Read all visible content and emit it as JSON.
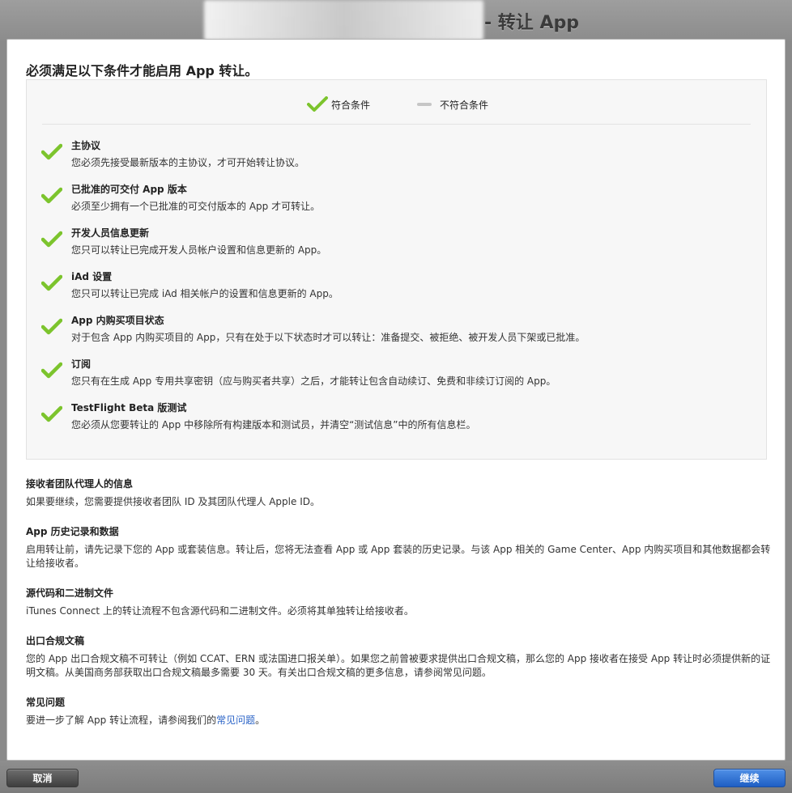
{
  "window": {
    "title": "- 转让 App"
  },
  "main": {
    "headline": "必须满足以下条件才能启用 App 转让。",
    "legend": {
      "met_label": "符合条件",
      "unmet_label": "不符合条件",
      "met_icon": "check-icon",
      "unmet_icon": "dash-icon"
    },
    "conditions": [
      {
        "title": "主协议",
        "desc": "您必须先接受最新版本的主协议，才可开始转让协议。",
        "status": "met"
      },
      {
        "title": "已批准的可交付 App 版本",
        "desc": "必须至少拥有一个已批准的可交付版本的 App 才可转让。",
        "status": "met"
      },
      {
        "title": "开发人员信息更新",
        "desc": "您只可以转让已完成开发人员帐户设置和信息更新的 App。",
        "status": "met"
      },
      {
        "title": "iAd 设置",
        "desc": "您只可以转让已完成 iAd 相关帐户的设置和信息更新的 App。",
        "status": "met"
      },
      {
        "title": "App 内购买项目状态",
        "desc": "对于包含 App 内购买项目的 App，只有在处于以下状态时才可以转让：准备提交、被拒绝、被开发人员下架或已批准。",
        "status": "met"
      },
      {
        "title": "订阅",
        "desc": "您只有在生成 App 专用共享密钥（应与购买者共享）之后，才能转让包含自动续订、免费和非续订订阅的 App。",
        "status": "met"
      },
      {
        "title": "TestFlight Beta 版测试",
        "desc": "您必须从您要转让的 App 中移除所有构建版本和测试员，并清空“测试信息”中的所有信息栏。",
        "status": "met"
      }
    ],
    "info": {
      "recipient": {
        "title": "接收者团队代理人的信息",
        "desc": "如果要继续，您需要提供接收者团队 ID 及其团队代理人 Apple ID。"
      },
      "history": {
        "title": "App 历史记录和数据",
        "desc": "启用转让前，请先记录下您的 App 或套装信息。转让后，您将无法查看 App 或 App 套装的历史记录。与该 App 相关的 Game Center、App 内购买项目和其他数据都会转让给接收者。"
      },
      "source": {
        "title": "源代码和二进制文件",
        "desc": "iTunes Connect 上的转让流程不包含源代码和二进制文件。必须将其单独转让给接收者。"
      },
      "export": {
        "title": "出口合规文稿",
        "desc": "您的 App 出口合规文稿不可转让（例如 CCAT、ERN 或法国进口报关单）。如果您之前曾被要求提供出口合规文稿，那么您的 App 接收者在接受 App 转让时必须提供新的证明文稿。从美国商务部获取出口合规文稿最多需要 30 天。有关出口合规文稿的更多信息，请参阅常见问题。"
      },
      "faq": {
        "title": "常见问题",
        "desc_prefix": "要进一步了解 App 转让流程，请参阅我们的",
        "link_text": "常见问题",
        "desc_suffix": "。"
      }
    }
  },
  "footer": {
    "cancel_label": "取消",
    "continue_label": "继续"
  },
  "colors": {
    "check_green": "#7cc42d",
    "link_blue": "#2a63c7",
    "primary_button": "#2f73d6"
  }
}
